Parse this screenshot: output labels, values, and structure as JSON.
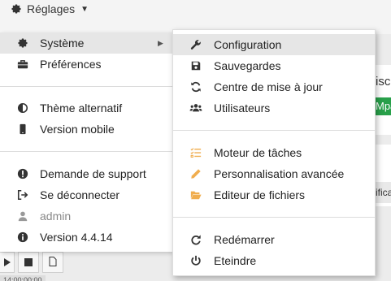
{
  "topbar": {
    "title": "Réglages",
    "icon": "gear-icon"
  },
  "background": {
    "heading_fragment": "isc",
    "green_fragment": "Mpa",
    "button_fragment": "ificat"
  },
  "bottom": {
    "time_fragment": "14:00:00:00"
  },
  "left_menu": {
    "items": [
      {
        "label": "Système",
        "icon": "gear-icon"
      },
      {
        "label": "Préférences",
        "icon": "briefcase-icon"
      },
      {
        "label": "Thème alternatif",
        "icon": "half-circle-icon"
      },
      {
        "label": "Version mobile",
        "icon": "mobile-icon"
      },
      {
        "label": "Demande de support",
        "icon": "exclamation-circle-icon"
      },
      {
        "label": "Se déconnecter",
        "icon": "sign-out-icon"
      },
      {
        "label": "admin",
        "icon": "user-icon"
      },
      {
        "label": "Version 4.4.14",
        "icon": "info-icon"
      }
    ]
  },
  "right_menu": {
    "items": [
      {
        "label": "Configuration",
        "icon": "wrench-icon"
      },
      {
        "label": "Sauvegardes",
        "icon": "save-icon"
      },
      {
        "label": "Centre de mise à jour",
        "icon": "refresh-icon"
      },
      {
        "label": "Utilisateurs",
        "icon": "users-icon"
      },
      {
        "label": "Moteur de tâches",
        "icon": "tasks-icon"
      },
      {
        "label": "Personnalisation avancée",
        "icon": "pencil-icon"
      },
      {
        "label": "Editeur de fichiers",
        "icon": "folder-open-icon"
      },
      {
        "label": "Redémarrer",
        "icon": "redo-icon"
      },
      {
        "label": "Eteindre",
        "icon": "power-icon"
      }
    ]
  },
  "colors": {
    "accent_orange": "#f0ad4e",
    "green": "#28a04a",
    "highlight": "#e6e6e6"
  }
}
